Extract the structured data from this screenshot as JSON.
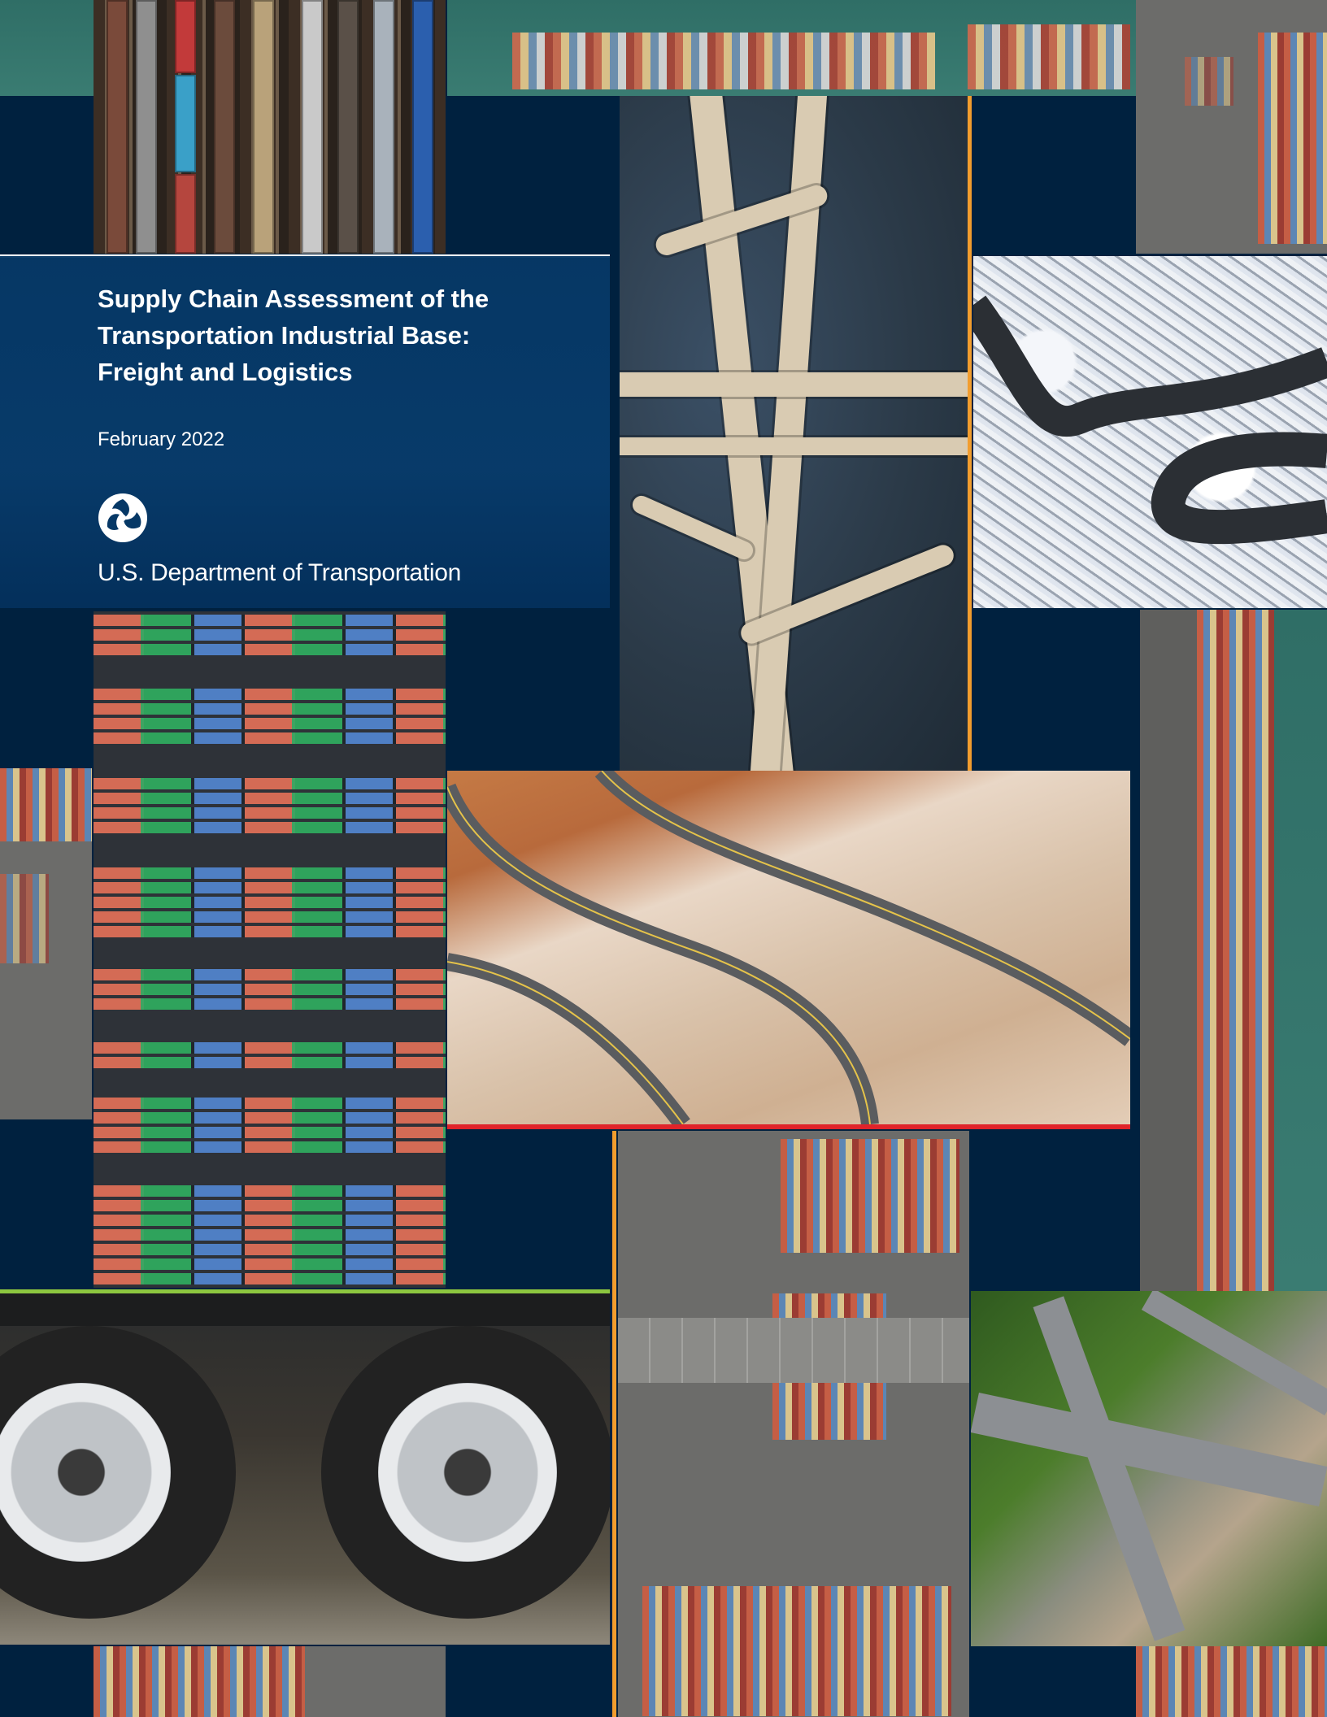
{
  "cover": {
    "title_line1": "Supply Chain Assessment of the",
    "title_line2": "Transportation Industrial Base:",
    "title_line3": "Freight and Logistics",
    "date": "February 2022",
    "agency": "U.S. Department of Transportation",
    "logo_icon": "dot-triskelion-icon"
  },
  "colors": {
    "navy": "#00213f",
    "panel_blue": "#063866",
    "accent_orange": "#f29d2e",
    "accent_red": "#e0232a",
    "accent_green": "#8cc63f"
  }
}
